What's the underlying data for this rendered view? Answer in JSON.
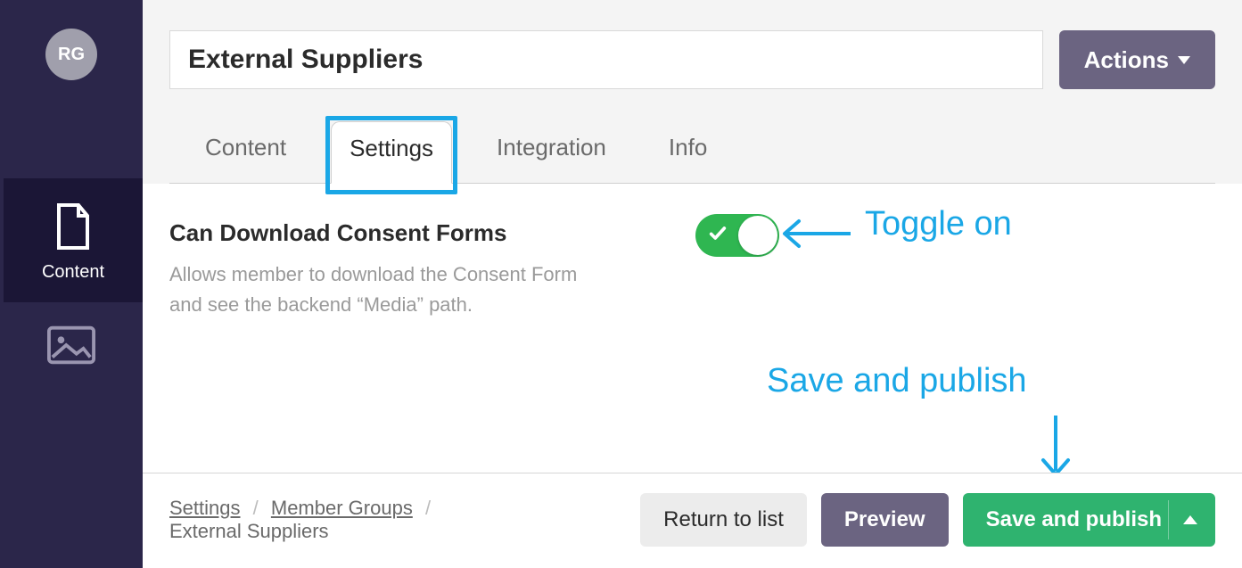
{
  "sidebar": {
    "avatar_initials": "RG",
    "items": [
      {
        "icon": "document-icon",
        "label": "Content",
        "active": true
      },
      {
        "icon": "image-icon",
        "label": "",
        "active": false
      }
    ]
  },
  "header": {
    "title_value": "External Suppliers",
    "actions_label": "Actions"
  },
  "tabs": [
    {
      "label": "Content",
      "active": false
    },
    {
      "label": "Settings",
      "active": true
    },
    {
      "label": "Integration",
      "active": false
    },
    {
      "label": "Info",
      "active": false
    }
  ],
  "setting": {
    "title": "Can Download Consent Forms",
    "description": "Allows member to download the Consent Form and see the backend “Media” path.",
    "toggle_on": true
  },
  "annotations": {
    "toggle_label": "Toggle on",
    "save_label": "Save and publish"
  },
  "footer": {
    "breadcrumb": {
      "part1": "Settings",
      "part2": "Member Groups",
      "current": "External Suppliers"
    },
    "return_label": "Return to list",
    "preview_label": "Preview",
    "save_label": "Save and publish"
  }
}
